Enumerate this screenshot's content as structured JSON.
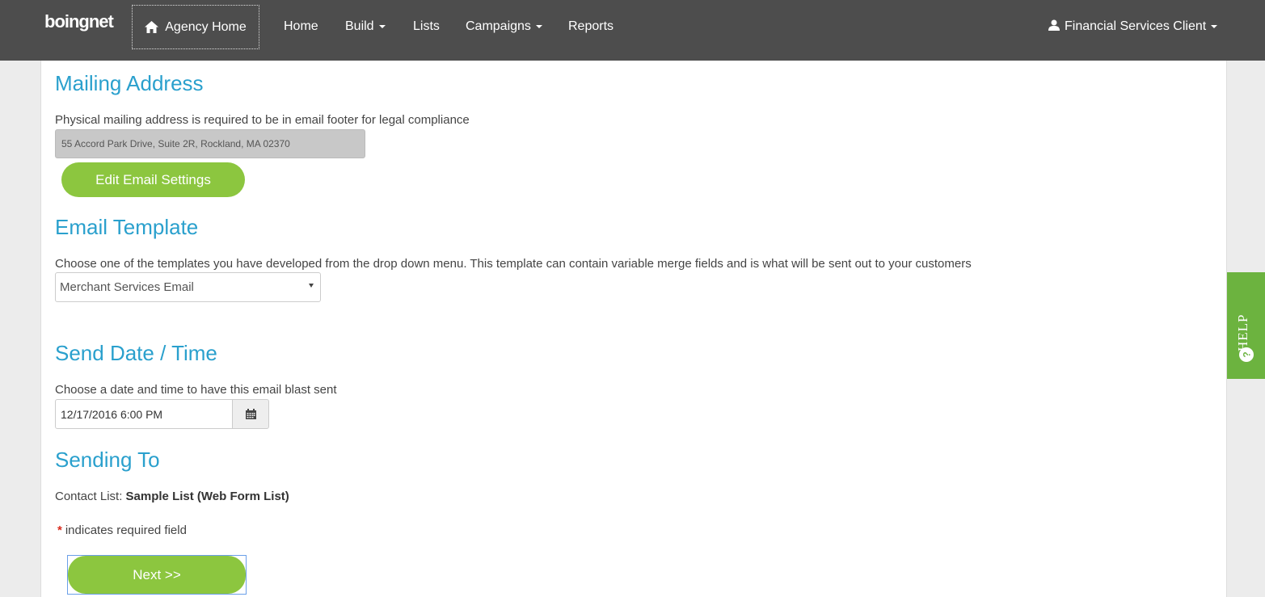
{
  "brand": {
    "logo_text": "boingnet"
  },
  "nav": {
    "agency_home": "Agency Home",
    "items": [
      {
        "label": "Home",
        "has_caret": false
      },
      {
        "label": "Build",
        "has_caret": true
      },
      {
        "label": "Lists",
        "has_caret": false
      },
      {
        "label": "Campaigns",
        "has_caret": true
      },
      {
        "label": "Reports",
        "has_caret": false
      }
    ],
    "user": "Financial Services Client"
  },
  "mailing": {
    "title": "Mailing Address",
    "description": "Physical mailing address is required to be in email footer for legal compliance",
    "address": "55 Accord Park Drive, Suite 2R, Rockland, MA 02370",
    "edit_button": "Edit Email Settings"
  },
  "template": {
    "title": "Email Template",
    "description": "Choose one of the templates you have developed from the drop down menu. This template can contain variable merge fields and is what will be sent out to your customers",
    "selected": "Merchant Services Email"
  },
  "send": {
    "title": "Send Date / Time",
    "description": "Choose a date and time to have this email blast sent",
    "datetime": "12/17/2016 6:00 PM"
  },
  "sending_to": {
    "title": "Sending To",
    "label": "Contact List:",
    "list_name": "Sample List (Web Form List)"
  },
  "required": {
    "star": "*",
    "text": "indicates required field"
  },
  "next_button": "Next >>",
  "help": {
    "label": "HELP",
    "icon": "question-icon"
  },
  "colors": {
    "accent": "#2aa0cd",
    "green": "#8cc63f",
    "topbar": "#4d4d4d",
    "help_green": "#6cb33f"
  }
}
